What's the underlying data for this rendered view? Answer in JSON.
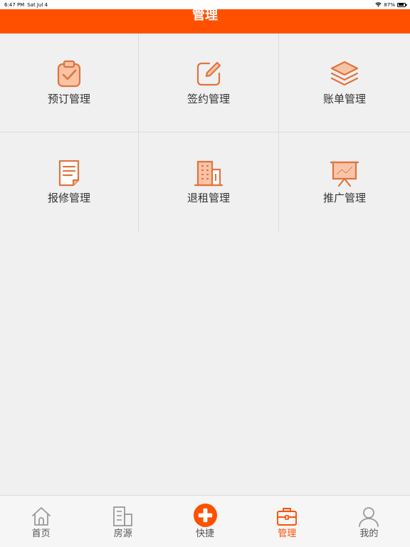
{
  "status_bar": {
    "time": "6:47 PM",
    "date": "Sat Jul 4",
    "battery": "87%",
    "battery_level": 0.87,
    "wifi_icon": "wifi-icon"
  },
  "header": {
    "title": "管理"
  },
  "colors": {
    "accent": "#ff5000",
    "icon_stroke": "#e0743f",
    "icon_fill": "#f9c3a6",
    "tab_inactive": "#999999"
  },
  "grid": {
    "items": [
      {
        "label": "预订管理",
        "icon": "clipboard-check-icon"
      },
      {
        "label": "签约管理",
        "icon": "edit-icon"
      },
      {
        "label": "账单管理",
        "icon": "layers-icon"
      },
      {
        "label": "报修管理",
        "icon": "document-icon"
      },
      {
        "label": "退租管理",
        "icon": "building-icon"
      },
      {
        "label": "推广管理",
        "icon": "presentation-chart-icon"
      }
    ]
  },
  "tab_bar": {
    "items": [
      {
        "label": "首页",
        "icon": "home-icon",
        "active": false
      },
      {
        "label": "房源",
        "icon": "building-icon",
        "active": false
      },
      {
        "label": "快捷",
        "icon": "plus-circle-icon",
        "active": false
      },
      {
        "label": "管理",
        "icon": "briefcase-icon",
        "active": true
      },
      {
        "label": "我的",
        "icon": "user-icon",
        "active": false
      }
    ]
  }
}
